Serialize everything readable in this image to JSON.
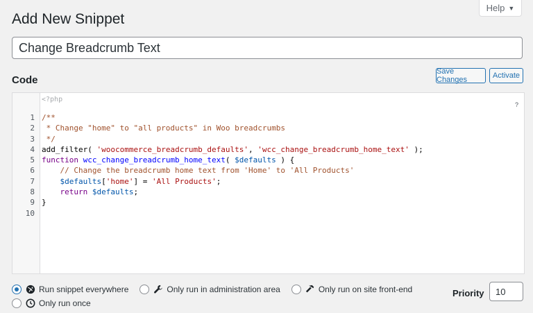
{
  "header": {
    "title": "Add New Snippet",
    "help_label": "Help"
  },
  "snippet": {
    "name_value": "Change Breadcrumb Text"
  },
  "code_section": {
    "label": "Code",
    "save_label": "Save Changes",
    "activate_label": "Activate",
    "php_open": "<?php",
    "help_mark": "?"
  },
  "code": {
    "lines": [
      {
        "num": "1",
        "tokens": [
          {
            "t": "/**",
            "c": "com"
          }
        ]
      },
      {
        "num": "2",
        "tokens": [
          {
            "t": " * Change \"home\" to \"all products\" in Woo breadcrumbs",
            "c": "com"
          }
        ]
      },
      {
        "num": "3",
        "tokens": [
          {
            "t": " */",
            "c": "com"
          }
        ]
      },
      {
        "num": "4",
        "tokens": [
          {
            "t": "add_filter( ",
            "c": "plain"
          },
          {
            "t": "'woocommerce_breadcrumb_defaults'",
            "c": "str"
          },
          {
            "t": ", ",
            "c": "plain"
          },
          {
            "t": "'wcc_change_breadcrumb_home_text'",
            "c": "str"
          },
          {
            "t": " );",
            "c": "plain"
          }
        ]
      },
      {
        "num": "5",
        "tokens": [
          {
            "t": "function",
            "c": "kw"
          },
          {
            "t": " ",
            "c": "plain"
          },
          {
            "t": "wcc_change_breadcrumb_home_text",
            "c": "def"
          },
          {
            "t": "( ",
            "c": "plain"
          },
          {
            "t": "$defaults",
            "c": "var"
          },
          {
            "t": " ) {",
            "c": "plain"
          }
        ]
      },
      {
        "num": "6",
        "tokens": [
          {
            "t": "    // Change the breadcrumb home text from 'Home' to 'All Products'",
            "c": "com"
          }
        ]
      },
      {
        "num": "7",
        "tokens": [
          {
            "t": "    ",
            "c": "plain"
          },
          {
            "t": "$defaults",
            "c": "var"
          },
          {
            "t": "[",
            "c": "plain"
          },
          {
            "t": "'home'",
            "c": "str"
          },
          {
            "t": "] = ",
            "c": "plain"
          },
          {
            "t": "'All Products'",
            "c": "str"
          },
          {
            "t": ";",
            "c": "plain"
          }
        ]
      },
      {
        "num": "8",
        "tokens": [
          {
            "t": "    ",
            "c": "plain"
          },
          {
            "t": "return",
            "c": "kw"
          },
          {
            "t": " ",
            "c": "plain"
          },
          {
            "t": "$defaults",
            "c": "var"
          },
          {
            "t": ";",
            "c": "plain"
          }
        ]
      },
      {
        "num": "9",
        "tokens": [
          {
            "t": "}",
            "c": "plain"
          }
        ]
      },
      {
        "num": "10",
        "tokens": []
      }
    ]
  },
  "scope": {
    "options": [
      {
        "label": "Run snippet everywhere",
        "icon": "globe-icon",
        "checked": true
      },
      {
        "label": "Only run in administration area",
        "icon": "wrench-icon",
        "checked": false
      },
      {
        "label": "Only run on site front-end",
        "icon": "hammer-icon",
        "checked": false
      },
      {
        "label": "Only run once",
        "icon": "clock-icon",
        "checked": false
      }
    ]
  },
  "priority": {
    "label": "Priority",
    "value": "10"
  },
  "colors": {
    "accent": "#2271b1",
    "background": "#f1f1f1"
  }
}
